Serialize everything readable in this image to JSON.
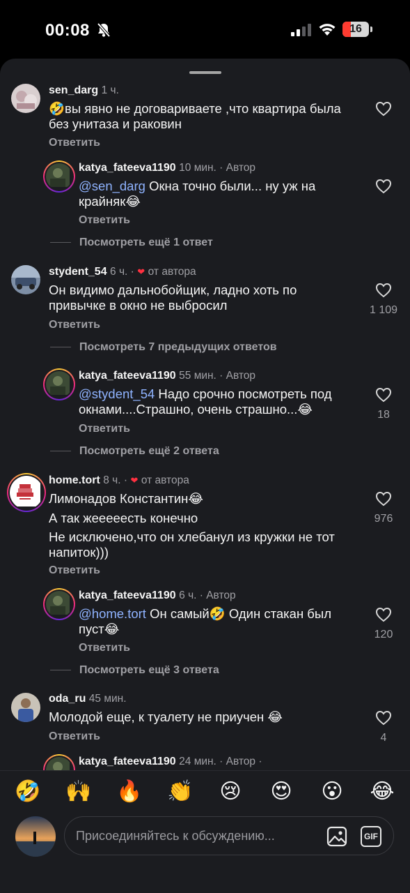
{
  "status_bar": {
    "time": "00:08",
    "battery": "16"
  },
  "comments": [
    {
      "user": "sen_darg",
      "time": "1 ч.",
      "text_emoji": "🤣",
      "text": "вы явно не договариваете ,что квартира была без унитаза и раковин",
      "reply_label": "Ответить"
    },
    {
      "user": "katya_fateeva1190",
      "time": "10 мин. · Автор",
      "mention": "@sen_darg",
      "text": " Окна точно были... ну уж на крайняк😂",
      "reply_label": "Ответить",
      "view_more": "Посмотреть ещё 1 ответ"
    },
    {
      "user": "stydent_54",
      "time": "6 ч. ·",
      "author_like": "от автора",
      "text": "Он видимо дальнобойщик, ладно хоть по привычке в окно не выбросил",
      "likes": "1 109",
      "reply_label": "Ответить",
      "view_more": "Посмотреть 7 предыдущих ответов"
    },
    {
      "user": "katya_fateeva1190",
      "time": "55 мин. · Автор",
      "mention": "@stydent_54",
      "text": " Надо срочно посмотреть под окнами....Страшно, очень страшно...😂",
      "likes": "18",
      "reply_label": "Ответить",
      "view_more": "Посмотреть ещё 2 ответа"
    },
    {
      "user": "home.tort",
      "time": "8 ч. ·",
      "author_like": "от автора",
      "text_lines": [
        "Лимонадов Константин😂",
        "А так жееееесть конечно",
        "Не исключено,что он хлебанул из кружки не тот напиток)))"
      ],
      "likes": "976",
      "reply_label": "Ответить"
    },
    {
      "user": "katya_fateeva1190",
      "time": "6 ч. · Автор",
      "mention": "@home.tort",
      "text": " Он самый🤣 Один стакан был пуст😂",
      "likes": "120",
      "reply_label": "Ответить",
      "view_more": "Посмотреть ещё 3 ответа"
    },
    {
      "user": "oda_ru",
      "time": "45 мин.",
      "text": "Молодой еще, к туалету не приучен 😂",
      "likes": "4",
      "reply_label": "Ответить"
    },
    {
      "user": "katya_fateeva1190",
      "time": "24 мин. · Автор ·"
    }
  ],
  "emoji_bar": [
    "🤣",
    "🙌",
    "🔥",
    "👏",
    "😢",
    "😍",
    "😮",
    "😂"
  ],
  "composer": {
    "placeholder": "Присоединяйтесь к обсуждению...",
    "gif_label": "GIF"
  },
  "colors": {
    "background": "#1b1c20",
    "mention": "#8fb3ff",
    "like_red": "#ff3040"
  }
}
